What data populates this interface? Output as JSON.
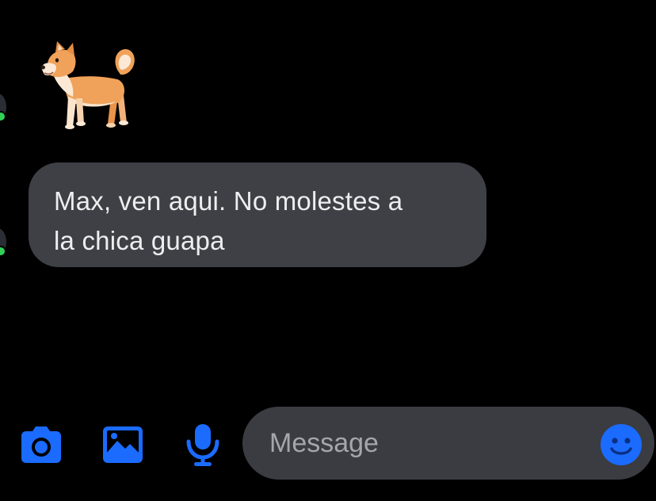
{
  "conversation": {
    "sticker": {
      "icon": "shiba-dog-sticker"
    },
    "message": {
      "line1": "Max, ven aqui. No molestes a",
      "line2": "la chica guapa"
    },
    "presence_color": "#31d158"
  },
  "composer": {
    "camera": {
      "icon": "camera-icon"
    },
    "gallery": {
      "icon": "image-icon"
    },
    "mic": {
      "icon": "microphone-icon"
    },
    "input": {
      "placeholder": "Message",
      "value": ""
    },
    "emoji": {
      "icon": "emoji-icon"
    },
    "accent_color": "#1b6bff"
  }
}
